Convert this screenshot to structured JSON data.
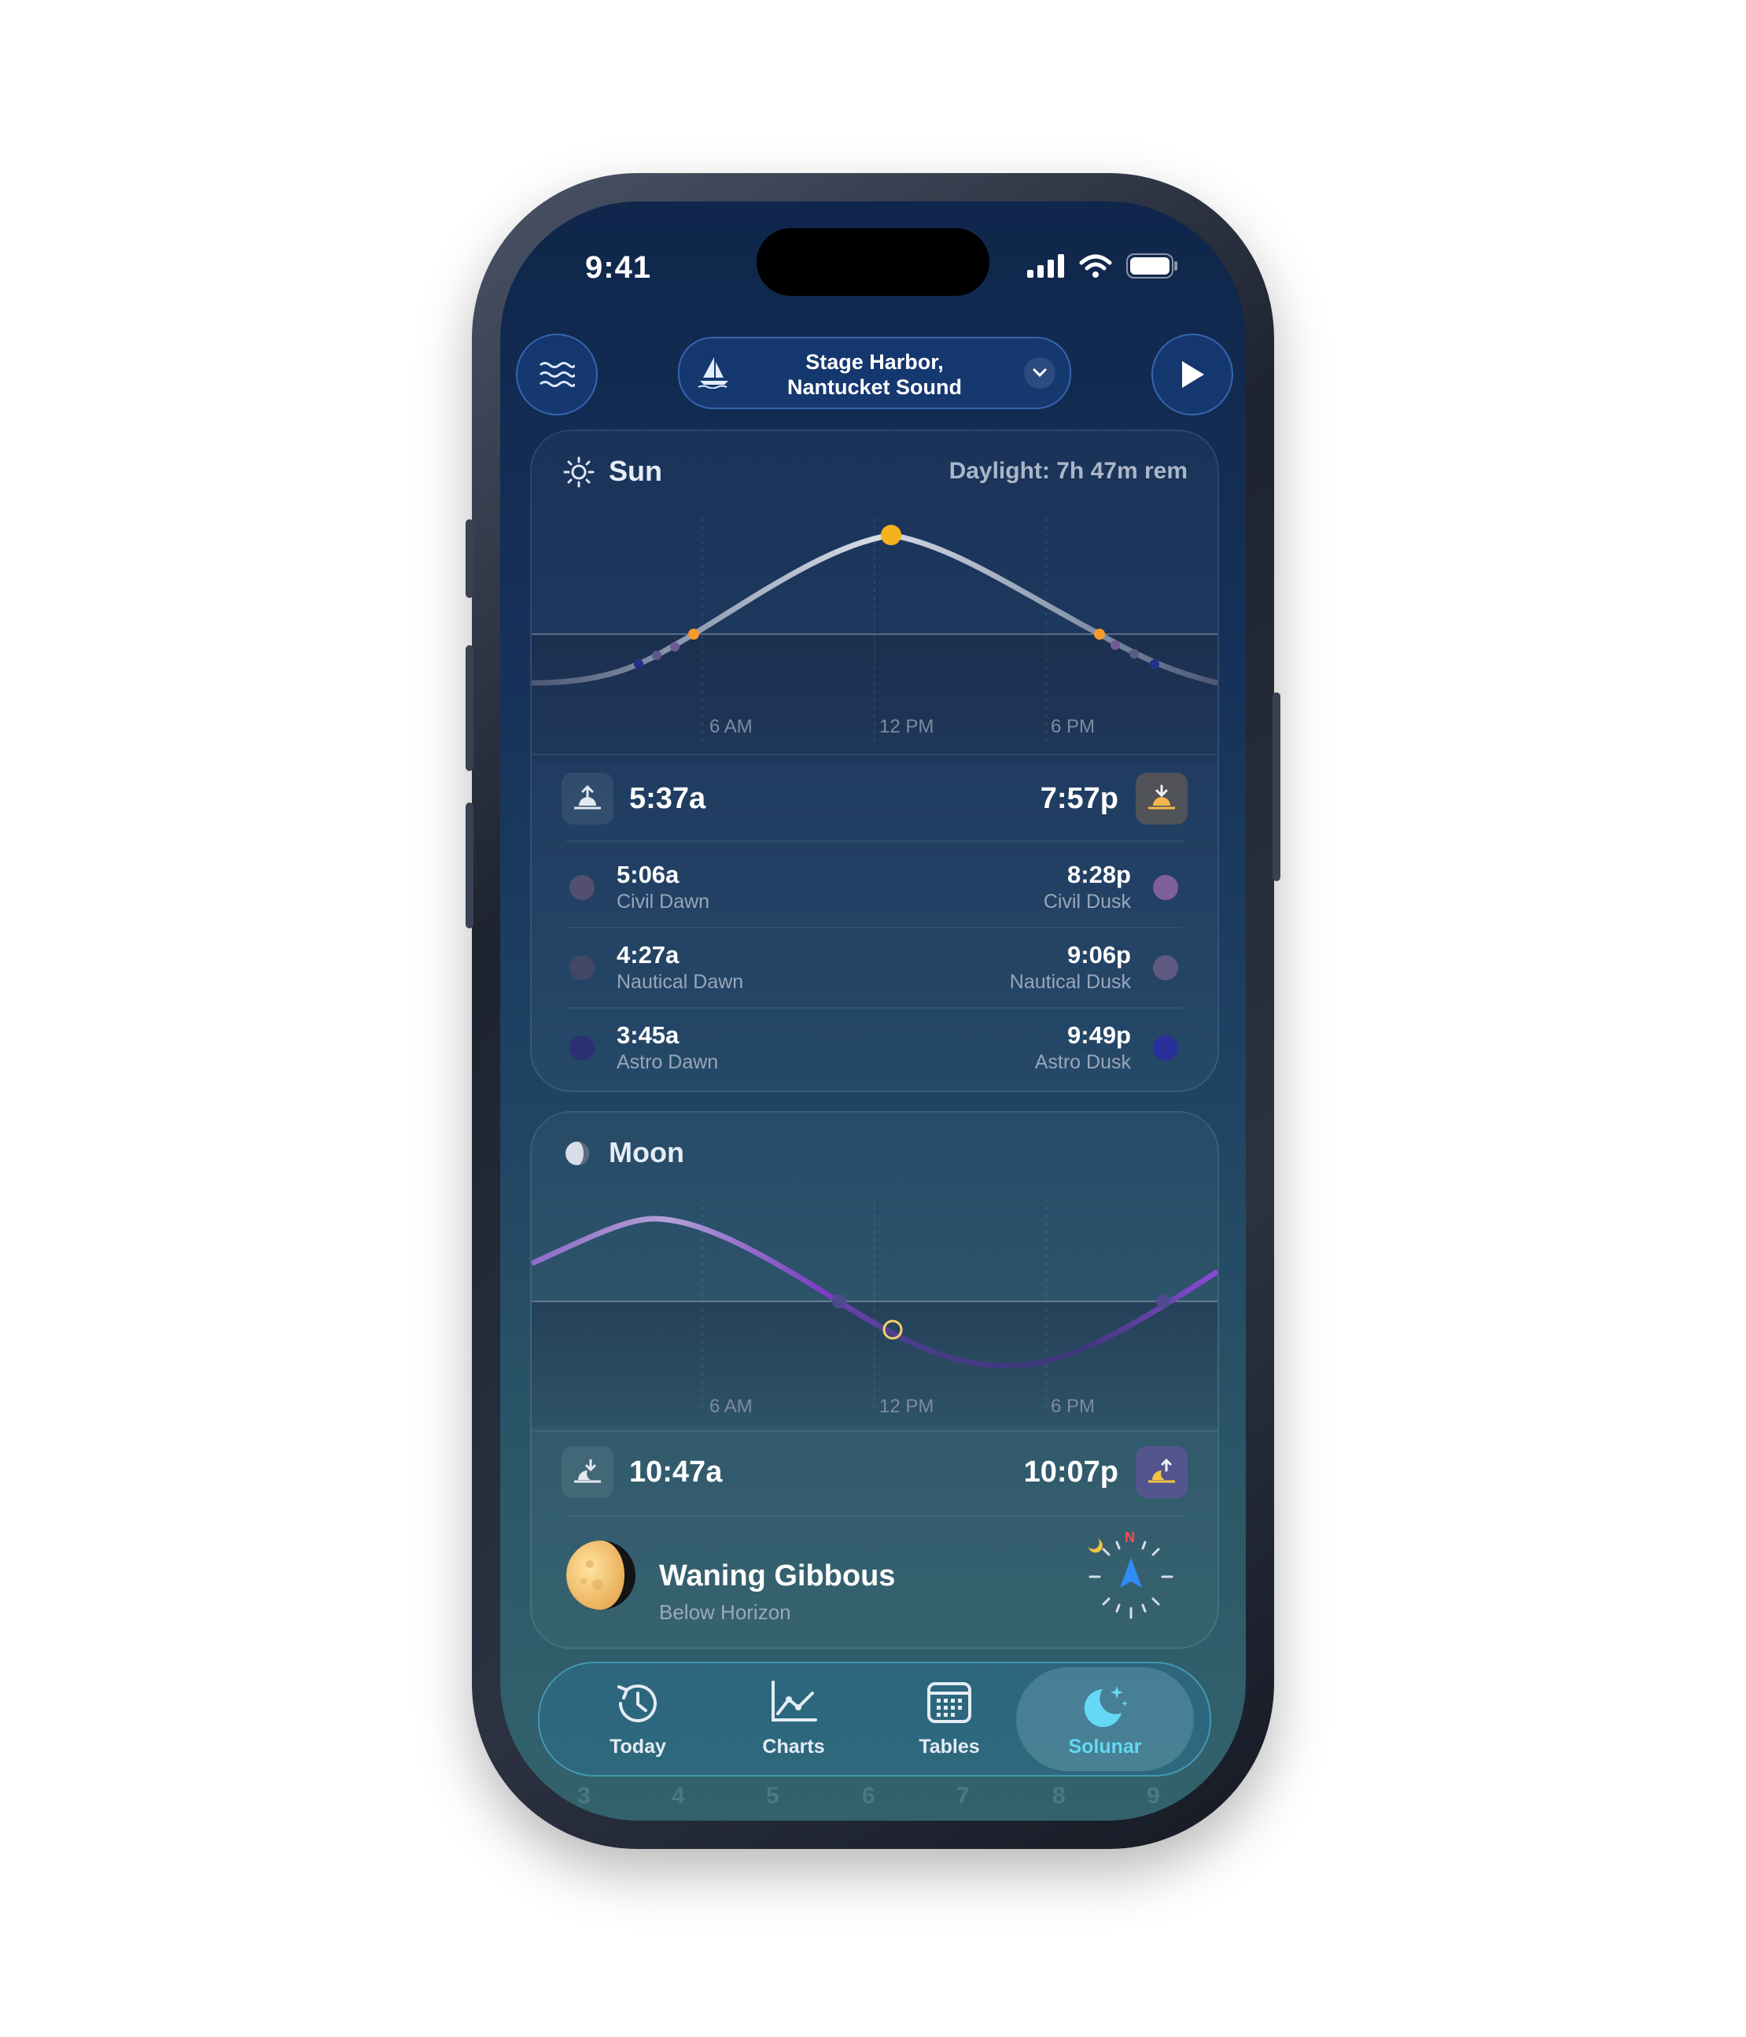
{
  "status": {
    "time": "9:41"
  },
  "header": {
    "location_line1": "Stage Harbor,",
    "location_line2": "Nantucket Sound"
  },
  "sun": {
    "title": "Sun",
    "daylight": "Daylight: 7h 47m rem",
    "ticks": [
      "6 AM",
      "12 PM",
      "6 PM"
    ],
    "sunrise": "5:37a",
    "sunset": "7:57p",
    "twilight": [
      {
        "dawn_time": "5:06a",
        "dawn_label": "Civil Dawn",
        "dusk_time": "8:28p",
        "dusk_label": "Civil Dusk",
        "dawn_color": "#52506e",
        "dusk_color": "#7e5f9a"
      },
      {
        "dawn_time": "4:27a",
        "dawn_label": "Nautical Dawn",
        "dusk_time": "9:06p",
        "dusk_label": "Nautical Dusk",
        "dawn_color": "#434766",
        "dusk_color": "#5f5a82"
      },
      {
        "dawn_time": "3:45a",
        "dawn_label": "Astro Dawn",
        "dusk_time": "9:49p",
        "dusk_label": "Astro Dusk",
        "dawn_color": "#2b3172",
        "dusk_color": "#2a2f9a"
      }
    ]
  },
  "moon": {
    "title": "Moon",
    "ticks": [
      "6 AM",
      "12 PM",
      "6 PM"
    ],
    "moonset": "10:47a",
    "moonrise": "10:07p",
    "phase": "Waning Gibbous",
    "position": "Below Horizon",
    "compass_n": "N"
  },
  "tabs": [
    {
      "label": "Today",
      "icon": "clock-refresh-icon"
    },
    {
      "label": "Charts",
      "icon": "line-chart-icon"
    },
    {
      "label": "Tables",
      "icon": "calendar-grid-icon"
    },
    {
      "label": "Solunar",
      "icon": "moon-stars-icon",
      "active": true
    }
  ],
  "calendar_days": [
    "3",
    "4",
    "5",
    "6",
    "7",
    "8",
    "9"
  ],
  "colors": {
    "accent": "#64d8f5",
    "sun": "#f6b21d",
    "moon_curve": "#8a5bc4"
  }
}
